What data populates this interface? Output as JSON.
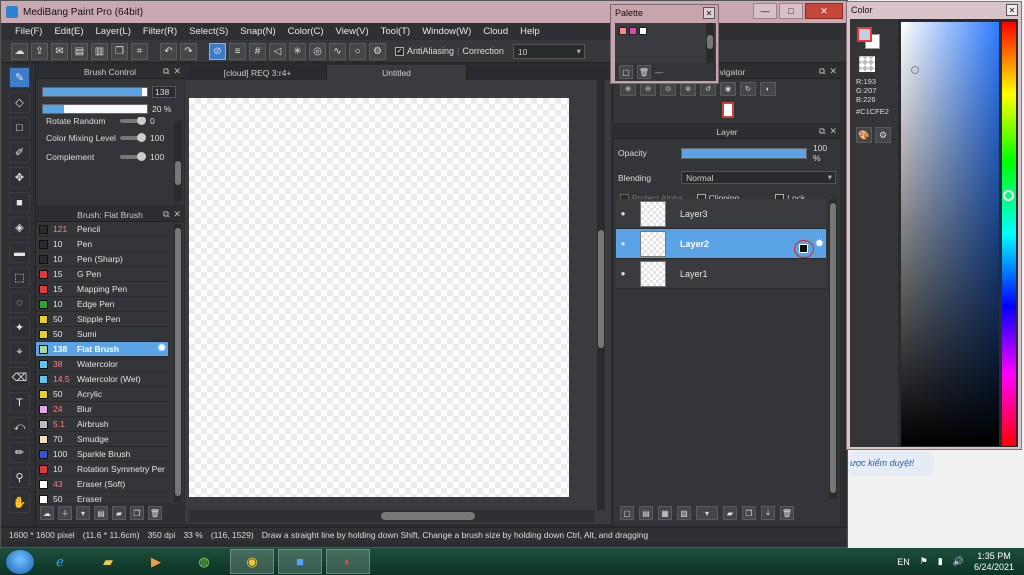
{
  "app": {
    "title": "MediBang Paint Pro (64bit)"
  },
  "window_controls": {
    "minimize": "—",
    "maximize": "□",
    "close": "✕"
  },
  "menu": [
    "File(F)",
    "Edit(E)",
    "Layer(L)",
    "Filter(R)",
    "Select(S)",
    "Snap(N)",
    "Color(C)",
    "View(V)",
    "Tool(T)",
    "Window(W)",
    "Cloud",
    "Help"
  ],
  "toolbar": {
    "antialiasing_label": "AntiAliasing",
    "antialiasing_checked": true,
    "correction_label": "Correction",
    "correction_value": "10"
  },
  "brush_control": {
    "title": "Brush Control",
    "size_value": "138",
    "size_fraction": 0.95,
    "opacity_value": "20 %",
    "opacity_fraction": 0.2,
    "props": [
      {
        "label": "Rotate Random",
        "value": "0"
      },
      {
        "label": "Color Mixing Level",
        "value": "100"
      },
      {
        "label": "Complement",
        "value": "100"
      }
    ]
  },
  "brush_list": {
    "title": "Brush: Flat Brush",
    "items": [
      {
        "size": "121",
        "name": "Pencil",
        "color": "#2b2b2b",
        "red": true
      },
      {
        "size": "10",
        "name": "Pen",
        "color": "#2b2b2b",
        "red": false
      },
      {
        "size": "10",
        "name": "Pen (Sharp)",
        "color": "#2b2b2b",
        "red": false
      },
      {
        "size": "15",
        "name": "G Pen",
        "color": "#e03b3b",
        "red": false
      },
      {
        "size": "15",
        "name": "Mapping Pen",
        "color": "#e03b3b",
        "red": false
      },
      {
        "size": "10",
        "name": "Edge Pen",
        "color": "#2aa52a",
        "red": false
      },
      {
        "size": "50",
        "name": "Stipple Pen",
        "color": "#e6d12a",
        "red": false
      },
      {
        "size": "50",
        "name": "Sumi",
        "color": "#e6d12a",
        "red": false
      },
      {
        "size": "138",
        "name": "Flat Brush",
        "color": "#a7d8a0",
        "red": true,
        "selected": true
      },
      {
        "size": "38",
        "name": "Watercolor",
        "color": "#5fc6f0",
        "red": true
      },
      {
        "size": "14.5",
        "name": "Watercolor (Wet)",
        "color": "#5fc6f0",
        "red": true
      },
      {
        "size": "50",
        "name": "Acrylic",
        "color": "#e6d12a",
        "red": false
      },
      {
        "size": "24",
        "name": "Blur",
        "color": "#e9a6e6",
        "red": true
      },
      {
        "size": "5.1",
        "name": "Airbrush",
        "color": "#bdbdbd",
        "red": true
      },
      {
        "size": "70",
        "name": "Smudge",
        "color": "#f4dcc0",
        "red": false
      },
      {
        "size": "100",
        "name": "Sparkle Brush",
        "color": "#3553d4",
        "red": false
      },
      {
        "size": "10",
        "name": "Rotation Symmetry Pen",
        "color": "#e03b3b",
        "red": false
      },
      {
        "size": "43",
        "name": "Eraser (Soft)",
        "color": "#ffffff",
        "red": true
      },
      {
        "size": "50",
        "name": "Eraser",
        "color": "#ffffff",
        "red": false
      }
    ]
  },
  "canvas_tabs": [
    "[cloud] REQ 3:r4+",
    "Untitled"
  ],
  "navigator": {
    "title": "Navigator"
  },
  "layer_panel": {
    "title": "Layer",
    "opacity_label": "Opacity",
    "opacity_value": "100 %",
    "blending_label": "Blending",
    "blending_value": "Normal",
    "protect_alpha": "Protect Alpha",
    "clipping": "Clipping",
    "lock": "Lock",
    "layers": [
      {
        "name": "Layer3",
        "selected": false
      },
      {
        "name": "Layer2",
        "selected": true
      },
      {
        "name": "Layer1",
        "selected": false
      }
    ]
  },
  "palette": {
    "title": "Palette",
    "swatches": [
      "#ff8a8a",
      "#d94dab",
      "#ffffff"
    ],
    "footer_text": "---"
  },
  "color": {
    "title": "Color",
    "r": "R:193",
    "g": "G:207",
    "b": "B:226",
    "hex": "#C1CFE2",
    "fg": "#C1CFE2"
  },
  "status": {
    "dimensions": "1600 * 1600 pixel",
    "physical": "(11.6 * 11.6cm)",
    "dpi": "350 dpi",
    "zoom": "33 %",
    "coords": "(116, 1529)",
    "hint": "Draw a straight line by holding down Shift, Change a brush size by holding down Ctrl, Alt, and dragging"
  },
  "background_page": {
    "bubble_text": "ược kiểm duyệt!"
  },
  "taskbar": {
    "language": "EN",
    "time": "1:35 PM",
    "date": "6/24/2021"
  }
}
